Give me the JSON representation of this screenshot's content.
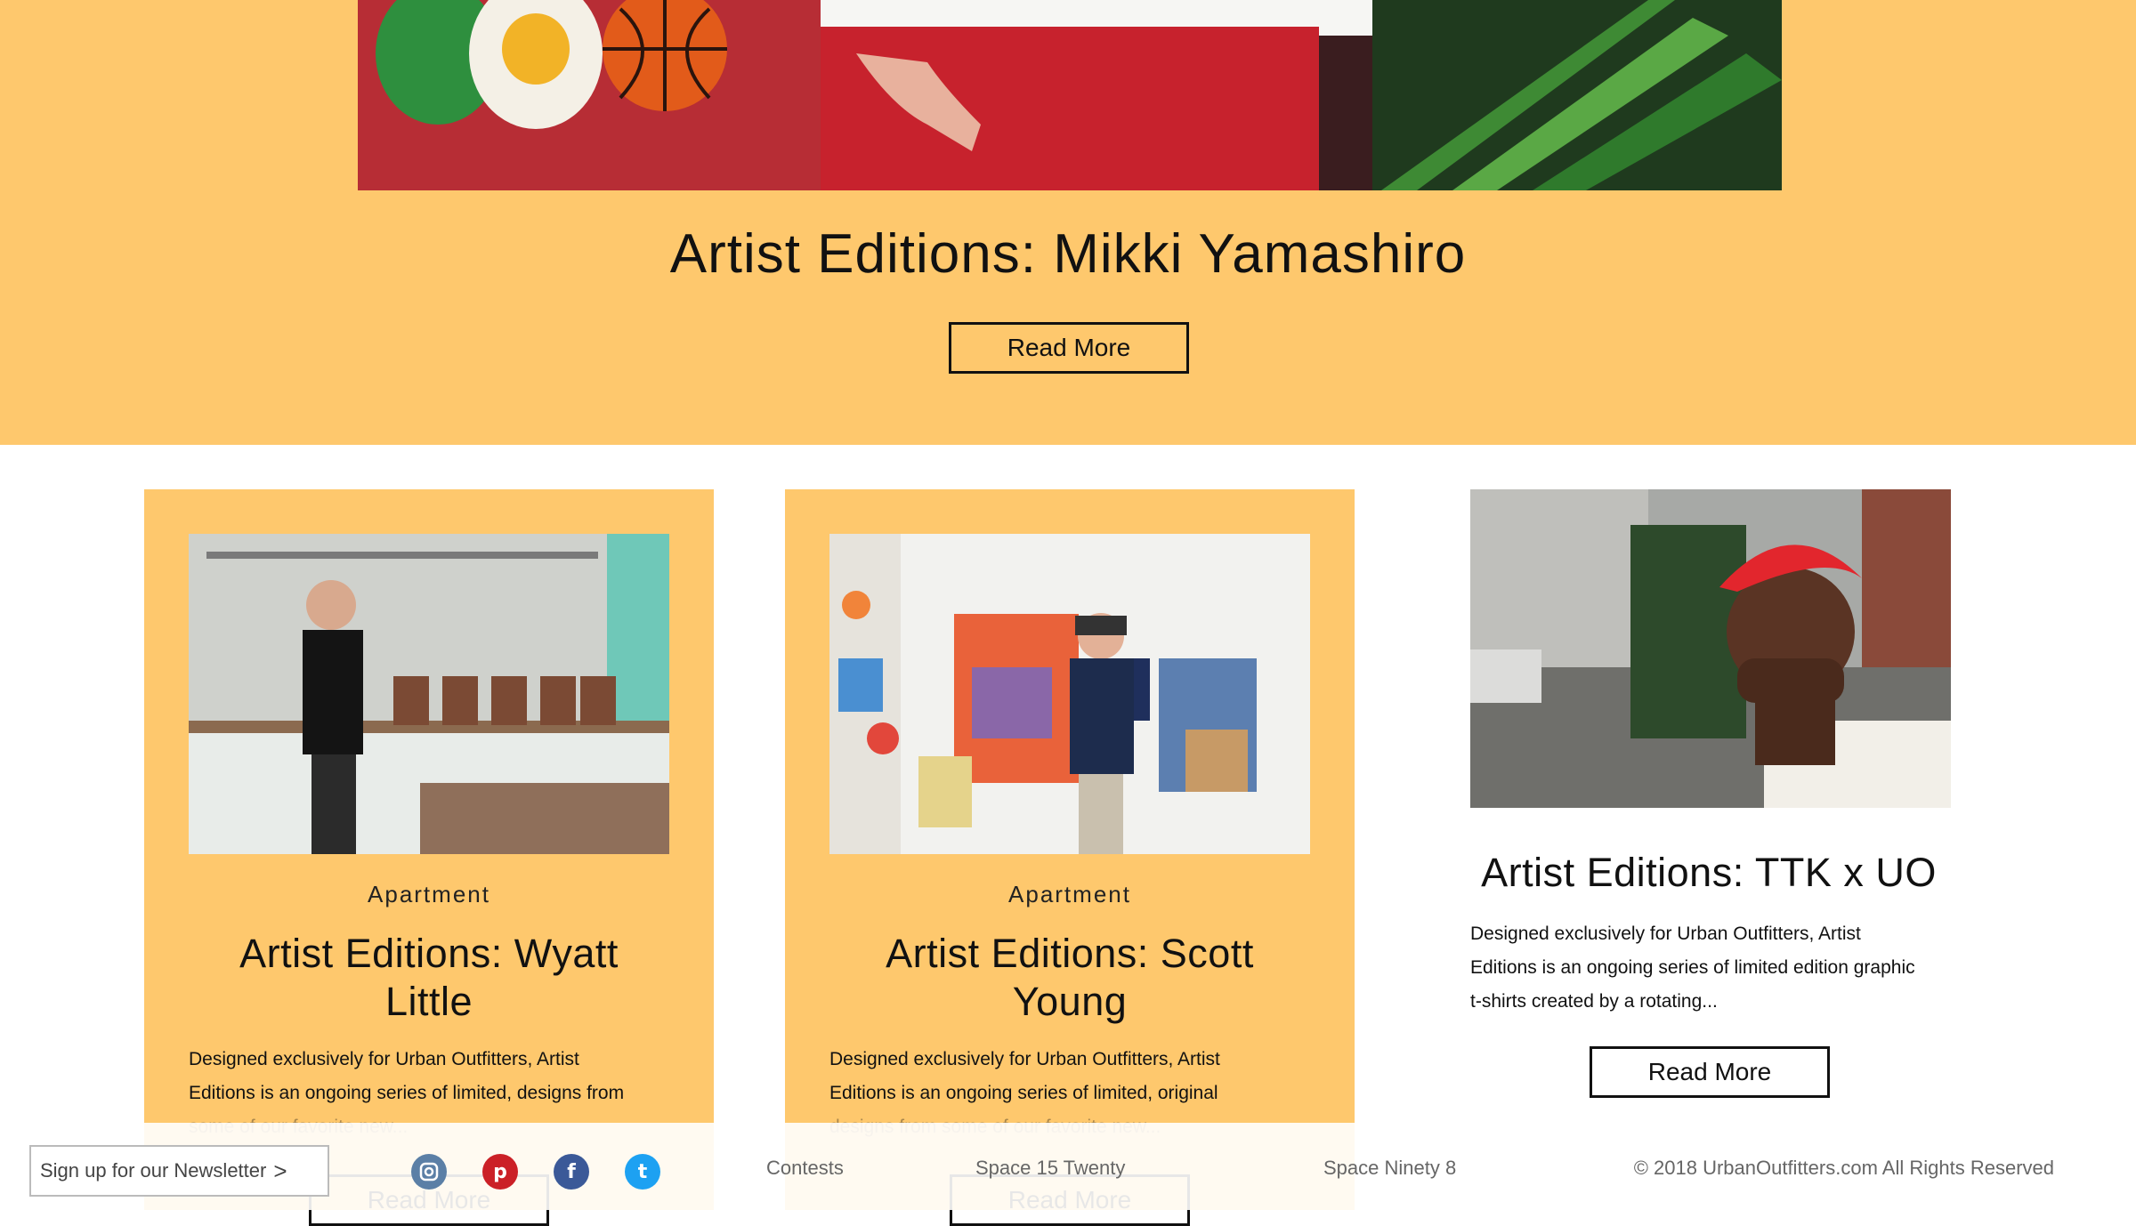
{
  "hero": {
    "title": "Artist Editions: Mikki Yamashiro",
    "button_label": "Read More"
  },
  "cards": [
    {
      "category": "Apartment",
      "title_line1": "Artist Editions: Wyatt",
      "title_line2": "Little",
      "excerpt_line1": "Designed exclusively for Urban Outfitters, Artist",
      "excerpt_line2": "Editions is an ongoing series of limited, designs from",
      "excerpt_line3": "some of our favorite new...",
      "button_label": "Read More"
    },
    {
      "category": "Apartment",
      "title_line1": "Artist Editions: Scott",
      "title_line2": "Young",
      "excerpt_line1": "Designed exclusively for Urban Outfitters, Artist",
      "excerpt_line2": "Editions is an ongoing series of limited, original",
      "excerpt_line3": "designs from some of our favorite new...",
      "button_label": "Read More"
    },
    {
      "title": "Artist Editions: TTK x UO",
      "excerpt_line1": "Designed exclusively for Urban Outfitters, Artist",
      "excerpt_line2": "Editions is an ongoing series of limited edition graphic",
      "excerpt_line3": "t-shirts created by a rotating...",
      "button_label": "Read More"
    }
  ],
  "footer": {
    "newsletter_label": "Sign up for our Newsletter",
    "newsletter_chevron": ">",
    "social": [
      {
        "name": "instagram-icon",
        "glyph": "◙",
        "color": "#5b7fa6"
      },
      {
        "name": "pinterest-icon",
        "glyph": "p",
        "color": "#cb2027"
      },
      {
        "name": "facebook-icon",
        "glyph": "f",
        "color": "#3b5998"
      },
      {
        "name": "twitter-icon",
        "glyph": "t",
        "color": "#1da1f2"
      }
    ],
    "links": [
      "Contests",
      "Space 15 Twenty",
      "Space Ninety 8"
    ],
    "copyright": "© 2018 UrbanOutfitters.com All Rights Reserved"
  },
  "colors": {
    "accent_yellow": "#fec86d",
    "text": "#111111"
  }
}
